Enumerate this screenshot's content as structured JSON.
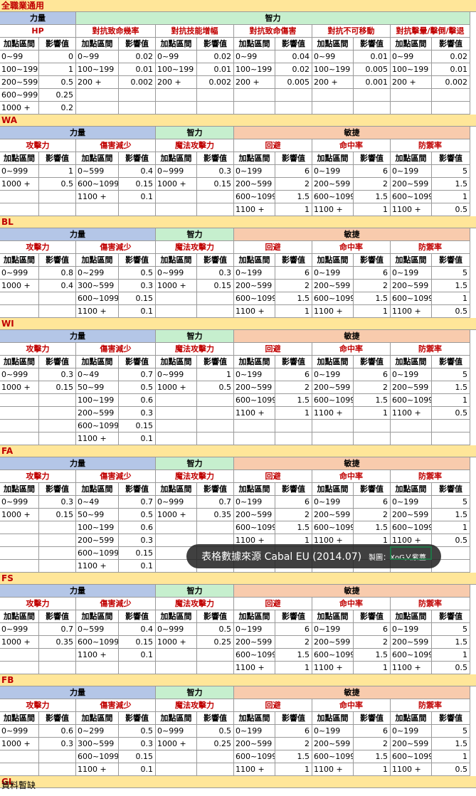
{
  "general": {
    "title": "全職業通用",
    "stat_labels": [
      "力量",
      "智力"
    ],
    "categories": [
      "HP",
      "對抗致命幾率",
      "對抗技能增幅",
      "對抗致命傷害",
      "對抗不可移動",
      "對抗擊暈/擊倒/擊退"
    ],
    "col_range": "加點區間",
    "col_effect": "影響值",
    "rows": [
      [
        "0~99",
        "0",
        "0~99",
        "0.02",
        "0~99",
        "0.02",
        "0~99",
        "0.04",
        "0~99",
        "0.01",
        "0~99",
        "0.02"
      ],
      [
        "100~199",
        "1",
        "100~199",
        "0.01",
        "100~199",
        "0.01",
        "100~199",
        "0.02",
        "100~199",
        "0.005",
        "100~199",
        "0.01"
      ],
      [
        "200~599",
        "0.5",
        "200 +",
        "0.002",
        "200 +",
        "0.002",
        "200 +",
        "0.005",
        "200 +",
        "0.001",
        "200 +",
        "0.002"
      ],
      [
        "600~999",
        "0.25",
        "",
        "",
        "",
        "",
        "",
        "",
        "",
        "",
        "",
        ""
      ],
      [
        "1000 +",
        "0.2",
        "",
        "",
        "",
        "",
        "",
        "",
        "",
        "",
        "",
        ""
      ]
    ]
  },
  "stat_labels": [
    "力量",
    "智力",
    "敏捷"
  ],
  "categories": [
    "攻擊力",
    "傷害減少",
    "魔法攻擊力",
    "回避",
    "命中率",
    "防禦率"
  ],
  "col_range": "加點區間",
  "col_effect": "影響值",
  "sections": [
    {
      "title": "WA",
      "rows": [
        [
          "0~999",
          "1",
          "0~599",
          "0.4",
          "0~999",
          "0.3",
          "0~199",
          "6",
          "0~199",
          "6",
          "0~199",
          "5"
        ],
        [
          "1000 +",
          "0.5",
          "600~1099",
          "0.15",
          "1000 +",
          "0.15",
          "200~599",
          "2",
          "200~599",
          "2",
          "200~599",
          "1.5"
        ],
        [
          "",
          "",
          "1100 +",
          "0.1",
          "",
          "",
          "600~1099",
          "1.5",
          "600~1099",
          "1.5",
          "600~1099",
          "1"
        ],
        [
          "",
          "",
          "",
          "",
          "",
          "",
          "1100 +",
          "1",
          "1100 +",
          "1",
          "1100 +",
          "0.5"
        ]
      ]
    },
    {
      "title": "BL",
      "rows": [
        [
          "0~999",
          "0.8",
          "0~299",
          "0.5",
          "0~999",
          "0.3",
          "0~199",
          "6",
          "0~199",
          "6",
          "0~199",
          "5"
        ],
        [
          "1000 +",
          "0.4",
          "300~599",
          "0.3",
          "1000 +",
          "0.15",
          "200~599",
          "2",
          "200~599",
          "2",
          "200~599",
          "1.5"
        ],
        [
          "",
          "",
          "600~1099",
          "0.15",
          "",
          "",
          "600~1099",
          "1.5",
          "600~1099",
          "1.5",
          "600~1099",
          "1"
        ],
        [
          "",
          "",
          "1100 +",
          "0.1",
          "",
          "",
          "1100 +",
          "1",
          "1100 +",
          "1",
          "1100 +",
          "0.5"
        ]
      ]
    },
    {
      "title": "WI",
      "rows": [
        [
          "0~999",
          "0.3",
          "0~49",
          "0.7",
          "0~999",
          "1",
          "0~199",
          "6",
          "0~199",
          "6",
          "0~199",
          "5"
        ],
        [
          "1000 +",
          "0.15",
          "50~99",
          "0.5",
          "1000 +",
          "0.5",
          "200~599",
          "2",
          "200~599",
          "2",
          "200~599",
          "1.5"
        ],
        [
          "",
          "",
          "100~199",
          "0.6",
          "",
          "",
          "600~1099",
          "1.5",
          "600~1099",
          "1.5",
          "600~1099",
          "1"
        ],
        [
          "",
          "",
          "200~599",
          "0.3",
          "",
          "",
          "1100 +",
          "1",
          "1100 +",
          "1",
          "1100 +",
          "0.5"
        ],
        [
          "",
          "",
          "600~1099",
          "0.15",
          "",
          "",
          "",
          "",
          "",
          "",
          "",
          ""
        ],
        [
          "",
          "",
          "1100 +",
          "0.1",
          "",
          "",
          "",
          "",
          "",
          "",
          "",
          ""
        ]
      ]
    },
    {
      "title": "FA",
      "rows": [
        [
          "0~999",
          "0.3",
          "0~49",
          "0.7",
          "0~999",
          "0.7",
          "0~199",
          "6",
          "0~199",
          "6",
          "0~199",
          "5"
        ],
        [
          "1000 +",
          "0.15",
          "50~99",
          "0.5",
          "1000 +",
          "0.35",
          "200~599",
          "2",
          "200~599",
          "2",
          "200~599",
          "1.5"
        ],
        [
          "",
          "",
          "100~199",
          "0.6",
          "",
          "",
          "600~1099",
          "1.5",
          "600~1099",
          "1.5",
          "600~1099",
          "1"
        ],
        [
          "",
          "",
          "200~599",
          "0.3",
          "",
          "",
          "1100 +",
          "1",
          "1100 +",
          "1",
          "1100 +",
          "0.5"
        ],
        [
          "",
          "",
          "600~1099",
          "0.15",
          "",
          "",
          "",
          "",
          "",
          "",
          "",
          ""
        ],
        [
          "",
          "",
          "1100 +",
          "0.1",
          "",
          "",
          "",
          "",
          "",
          "",
          "",
          ""
        ]
      ]
    },
    {
      "title": "FS",
      "rows": [
        [
          "0~999",
          "0.7",
          "0~599",
          "0.4",
          "0~999",
          "0.5",
          "0~199",
          "6",
          "0~199",
          "6",
          "0~199",
          "5"
        ],
        [
          "1000 +",
          "0.35",
          "600~1099",
          "0.15",
          "1000 +",
          "0.25",
          "200~599",
          "2",
          "200~599",
          "2",
          "200~599",
          "1.5"
        ],
        [
          "",
          "",
          "1100 +",
          "0.1",
          "",
          "",
          "600~1099",
          "1.5",
          "600~1099",
          "1.5",
          "600~1099",
          "1"
        ],
        [
          "",
          "",
          "",
          "",
          "",
          "",
          "1100 +",
          "1",
          "1100 +",
          "1",
          "1100 +",
          "0.5"
        ]
      ]
    },
    {
      "title": "FB",
      "rows": [
        [
          "0~999",
          "0.6",
          "0~299",
          "0.5",
          "0~999",
          "0.5",
          "0~199",
          "6",
          "0~199",
          "6",
          "0~199",
          "5"
        ],
        [
          "1000 +",
          "0.3",
          "300~599",
          "0.3",
          "1000 +",
          "0.25",
          "200~599",
          "2",
          "200~599",
          "2",
          "200~599",
          "1.5"
        ],
        [
          "",
          "",
          "600~1099",
          "0.15",
          "",
          "",
          "600~1099",
          "1.5",
          "600~1099",
          "1.5",
          "600~1099",
          "1"
        ],
        [
          "",
          "",
          "1100 +",
          "0.1",
          "",
          "",
          "1100 +",
          "1",
          "1100 +",
          "1",
          "1100 +",
          "0.5"
        ]
      ]
    }
  ],
  "last_section_title": "GL",
  "footer": "資料暫缺",
  "overlay": {
    "main": "表格數據來源 Cabal EU (2014.07)",
    "credit": "製圖：XoG乂紫薹"
  },
  "colors": {
    "title_bg": "#ffe699",
    "str_bg": "#b4c6e7",
    "int_bg": "#c6efce",
    "dex_bg": "#f8cbad",
    "red_text": "#c00000"
  }
}
